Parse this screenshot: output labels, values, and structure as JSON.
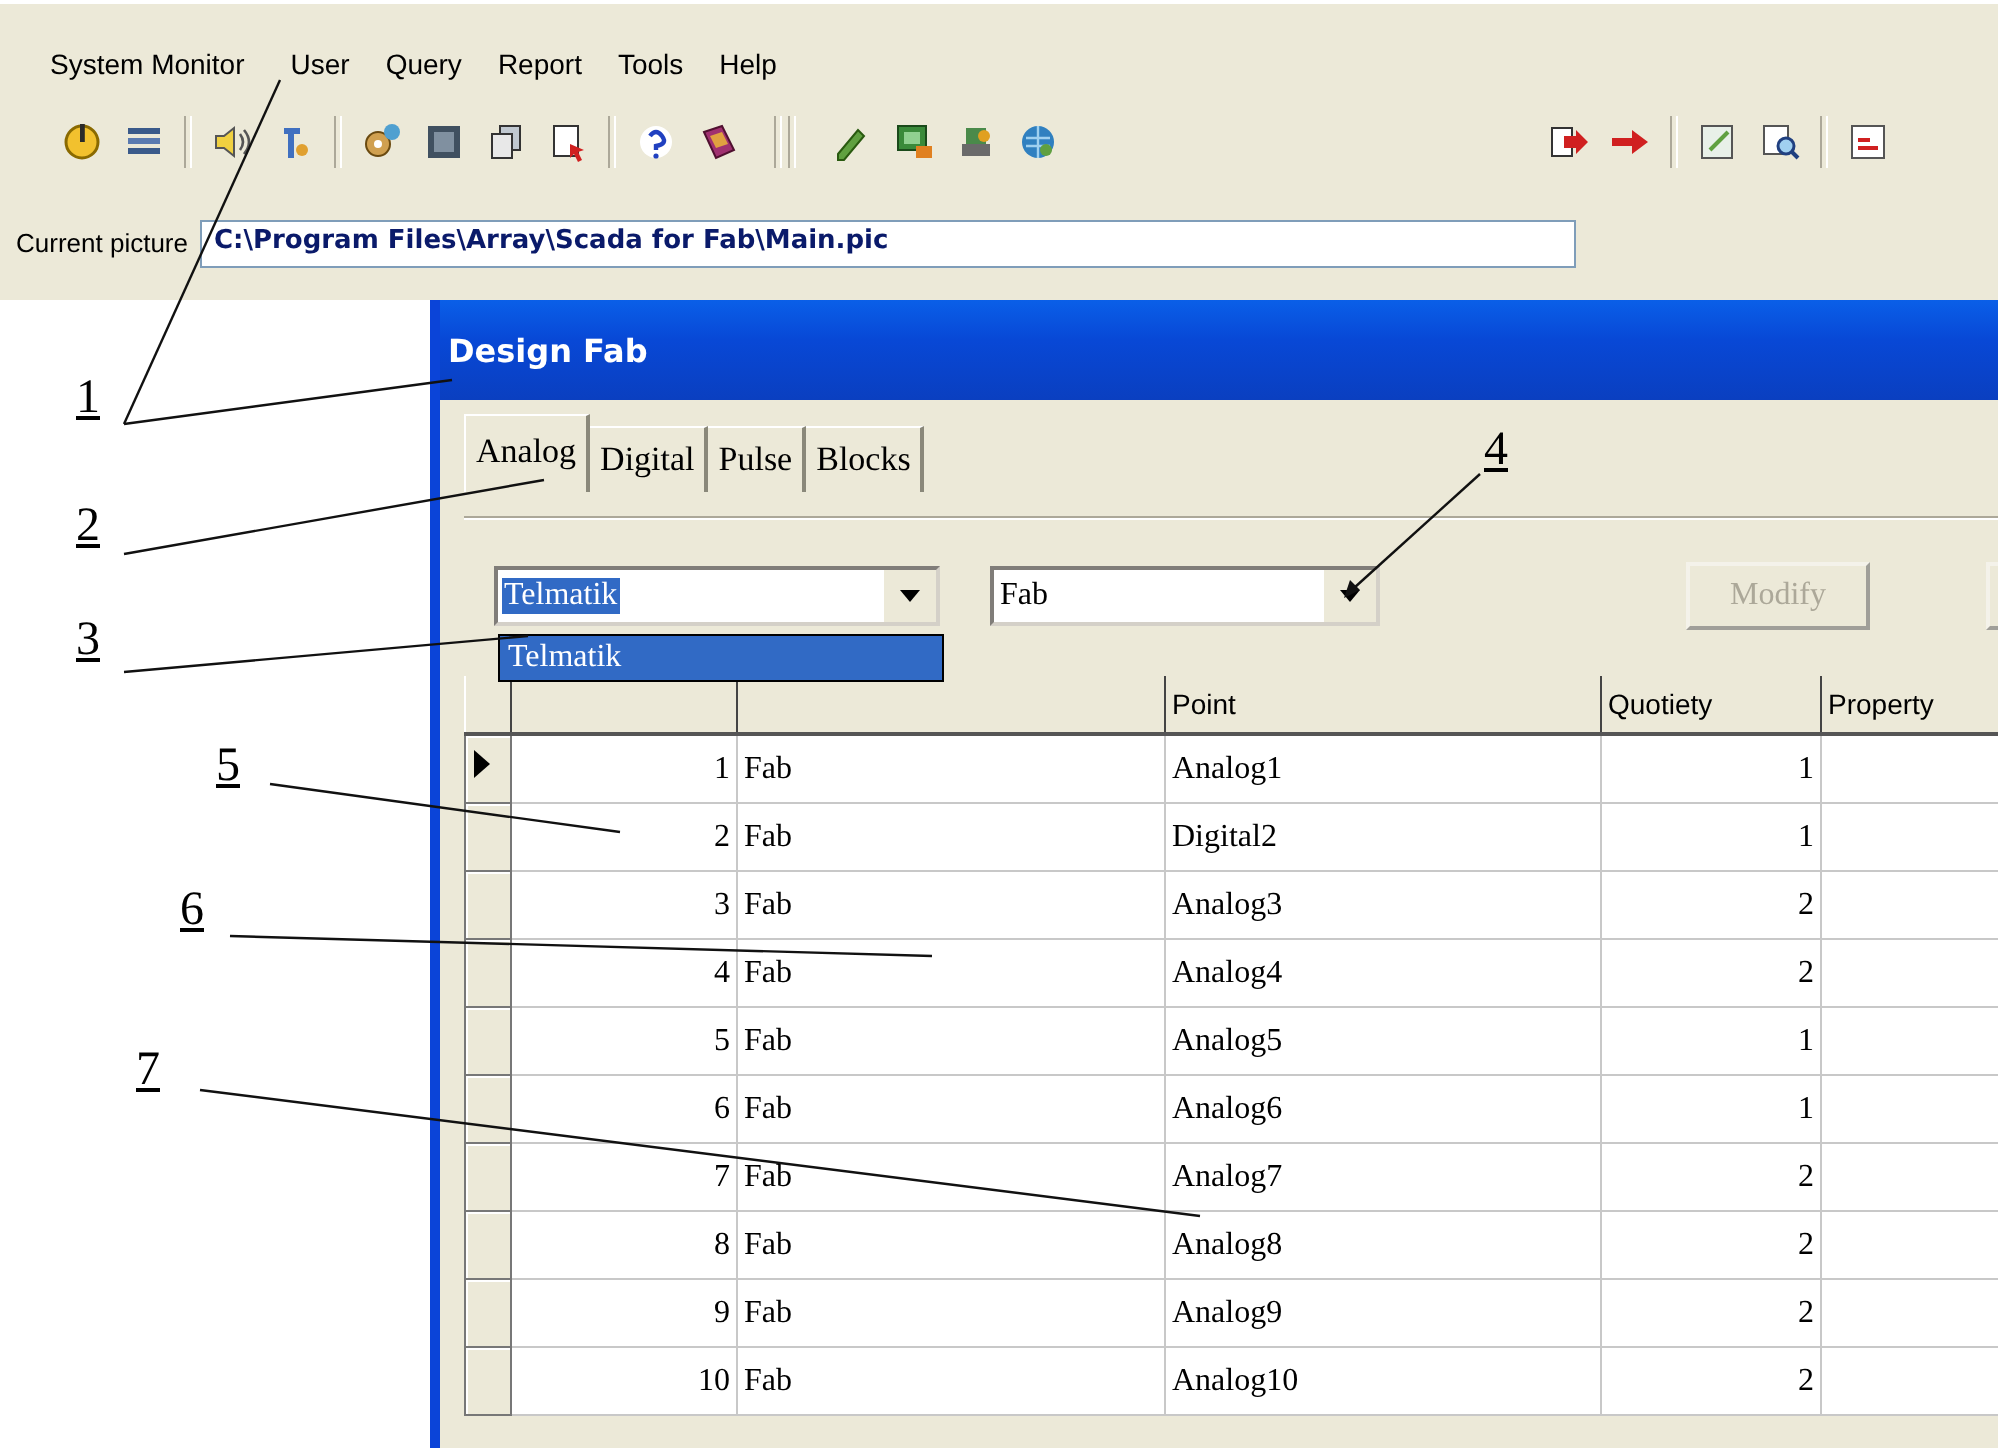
{
  "menu": [
    {
      "label": "System Monitor"
    },
    {
      "label": "User"
    },
    {
      "label": "Query"
    },
    {
      "label": "Report"
    },
    {
      "label": "Tools"
    },
    {
      "label": "Help"
    }
  ],
  "current_picture": {
    "label": "Current picture",
    "value": "C:\\Program Files\\Array\\Scada for Fab\\Main.pic"
  },
  "window": {
    "title": "Design Fab"
  },
  "tabs": [
    {
      "label": "Analog",
      "selected": true
    },
    {
      "label": "Digital",
      "selected": false
    },
    {
      "label": "Pulse",
      "selected": false
    },
    {
      "label": "Blocks",
      "selected": false
    }
  ],
  "filters": [
    {
      "value": "Telmatik",
      "highlighted": true,
      "dropdown": [
        {
          "label": "Telmatik",
          "selected": true
        }
      ]
    },
    {
      "value": "Fab",
      "highlighted": false
    }
  ],
  "buttons": [
    {
      "label": "Modify",
      "disabled": true
    }
  ],
  "table": {
    "columns": [
      "",
      "",
      "Point",
      "Quotiety",
      "Property"
    ],
    "rows": [
      {
        "selected": true,
        "cells": [
          "1",
          "Fab",
          "Analog1",
          "1"
        ]
      },
      {
        "selected": false,
        "cells": [
          "2",
          "Fab",
          "Digital2",
          "1"
        ]
      },
      {
        "selected": false,
        "cells": [
          "3",
          "Fab",
          "Analog3",
          "2"
        ]
      },
      {
        "selected": false,
        "cells": [
          "4",
          "Fab",
          "Analog4",
          "2"
        ]
      },
      {
        "selected": false,
        "cells": [
          "5",
          "Fab",
          "Analog5",
          "1"
        ]
      },
      {
        "selected": false,
        "cells": [
          "6",
          "Fab",
          "Analog6",
          "1"
        ]
      },
      {
        "selected": false,
        "cells": [
          "7",
          "Fab",
          "Analog7",
          "2"
        ]
      },
      {
        "selected": false,
        "cells": [
          "8",
          "Fab",
          "Analog8",
          "2"
        ]
      },
      {
        "selected": false,
        "cells": [
          "9",
          "Fab",
          "Analog9",
          "2"
        ]
      },
      {
        "selected": false,
        "cells": [
          "10",
          "Fab",
          "Analog10",
          "2"
        ]
      }
    ]
  },
  "callouts": [
    {
      "label": "1"
    },
    {
      "label": "2"
    },
    {
      "label": "3"
    },
    {
      "label": "4"
    },
    {
      "label": "5"
    },
    {
      "label": "6"
    },
    {
      "label": "7"
    }
  ]
}
